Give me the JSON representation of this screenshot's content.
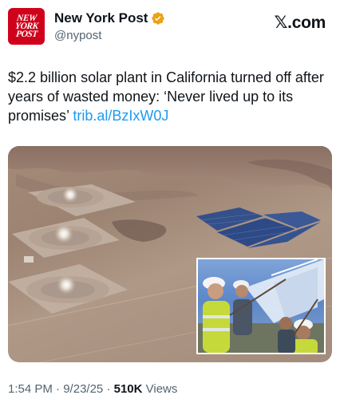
{
  "account": {
    "display_name": "New York Post",
    "handle": "@nypost",
    "avatar_lines": [
      "NEW",
      "YORK",
      "POST"
    ]
  },
  "brand": {
    "site": ".com",
    "x_glyph": "𝕏"
  },
  "tweet": {
    "text": "$2.2 billion solar plant in California turned off after years of wasted money: ‘Never lived up to its promises’",
    "link": "trib.al/BzIxW0J"
  },
  "meta": {
    "time": "1:54 PM",
    "date": "9/23/25",
    "views_count": "510K",
    "views_label": "Views",
    "separator": "·"
  },
  "colors": {
    "link": "#1d9bf0",
    "verified": "#e8a317",
    "avatar_bg": "#d0021b",
    "secondary_text": "#536471"
  },
  "icons": {
    "verified": "verified-badge-icon",
    "x_logo": "x-logo-icon"
  }
}
